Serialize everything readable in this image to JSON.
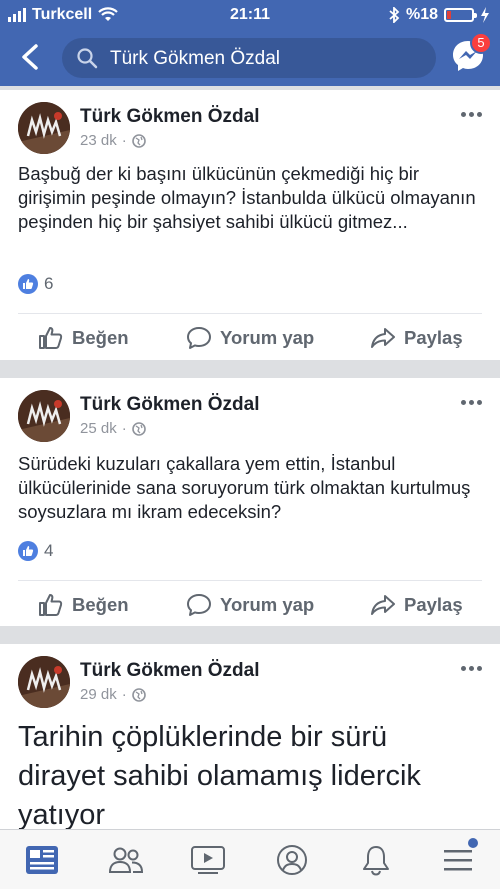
{
  "status_bar": {
    "carrier": "Turkcell",
    "time": "21:11",
    "battery": "%18",
    "battery_level": 0.18
  },
  "header": {
    "search_text": "Türk Gökmen Özdal",
    "messenger_badge": "5"
  },
  "posts": [
    {
      "author": "Türk Gökmen Özdal",
      "time": "23 dk",
      "separator": "·",
      "text": "Başbuğ der ki başını ülkücünün çekmediği hiç bir girişimin peşinde olmayın? İstanbulda ülkücü olmayanın peşinden hiç bir şahsiyet sahibi ülkücü gitmez...",
      "likes": "6"
    },
    {
      "author": "Türk Gökmen Özdal",
      "time": "25 dk",
      "separator": "·",
      "text": "Sürüdeki kuzuları çakallara yem ettin, İstanbul ülkücülerinide sana soruyorum türk olmaktan kurtulmuş soysuzlara mı ikram edeceksin?",
      "likes": "4"
    },
    {
      "author": "Türk Gökmen Özdal",
      "time": "29 dk",
      "separator": "·",
      "text": "Tarihin çöplüklerinde bir sürü dirayet sahibi olamamış lidercik yatıyor"
    }
  ],
  "actions": {
    "like": "Beğen",
    "comment": "Yorum yap",
    "share": "Paylaş"
  },
  "colors": {
    "brand": "#4267b2",
    "search_bg": "#385898",
    "badge": "#fa3e3e",
    "like_blue": "#4e7fe0"
  },
  "icons": [
    "back-arrow-icon",
    "search-icon",
    "messenger-icon",
    "globe-icon",
    "like-icon",
    "comment-icon",
    "share-icon",
    "news-feed-icon",
    "friends-icon",
    "watch-icon",
    "profile-icon",
    "notifications-icon",
    "menu-icon"
  ]
}
